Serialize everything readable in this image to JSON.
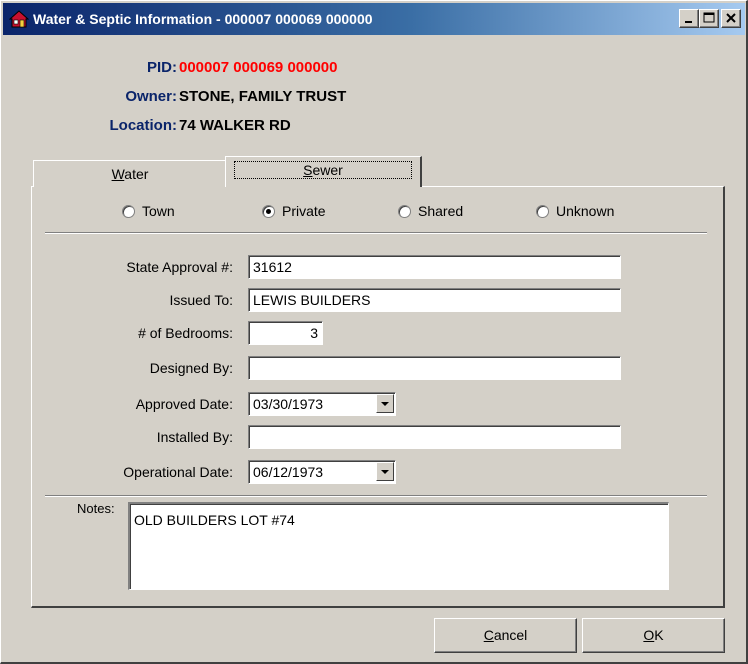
{
  "window": {
    "title": "Water & Septic Information - 000007  000069  000000",
    "icon": "house-icon"
  },
  "header": {
    "pid_label": "PID:",
    "pid_value": "000007  000069  000000",
    "owner_label": "Owner:",
    "owner_value": "STONE, FAMILY TRUST",
    "location_label": "Location:",
    "location_value": "74 WALKER RD"
  },
  "tabs": [
    {
      "label": "Water",
      "mnemonic": "W",
      "rest": "ater",
      "active": false
    },
    {
      "label": "Sewer",
      "mnemonic": "S",
      "rest": "ewer",
      "active": true
    }
  ],
  "sewer_type": {
    "options": [
      "Town",
      "Private",
      "Shared",
      "Unknown"
    ],
    "selected": "Private"
  },
  "form": {
    "state_approval_label": "State Approval #:",
    "state_approval_value": "31612",
    "issued_to_label": "Issued To:",
    "issued_to_value": "LEWIS BUILDERS",
    "bedrooms_label": "# of Bedrooms:",
    "bedrooms_value": "3",
    "designed_by_label": "Designed By:",
    "designed_by_value": "",
    "approved_date_label": "Approved Date:",
    "approved_date_value": "03/30/1973",
    "installed_by_label": "Installed By:",
    "installed_by_value": "",
    "operational_date_label": "Operational Date:",
    "operational_date_value": "06/12/1973",
    "notes_label": "Notes:",
    "notes_value": "OLD BUILDERS LOT #74"
  },
  "buttons": {
    "cancel_label": "Cancel",
    "cancel_mnemonic": "C",
    "cancel_rest": "ancel",
    "ok_label": "OK",
    "ok_mnemonic": "O",
    "ok_rest": "K"
  },
  "colors": {
    "title_start": "#0a246a",
    "title_end": "#a6caf0",
    "label_blue": "#0a246a",
    "pid_red": "#ff0000",
    "face": "#d4d0c8"
  }
}
